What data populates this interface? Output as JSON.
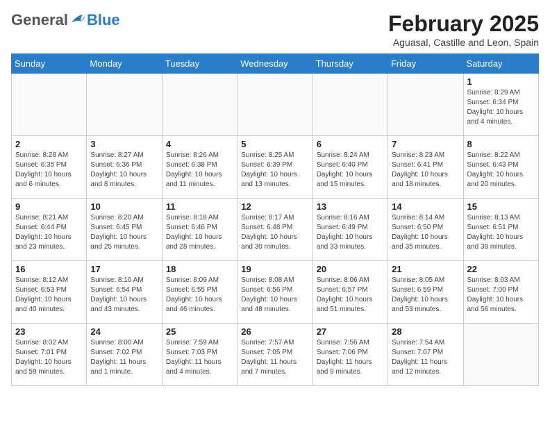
{
  "header": {
    "logo_general": "General",
    "logo_blue": "Blue",
    "month": "February 2025",
    "location": "Aguasal, Castille and Leon, Spain"
  },
  "weekdays": [
    "Sunday",
    "Monday",
    "Tuesday",
    "Wednesday",
    "Thursday",
    "Friday",
    "Saturday"
  ],
  "weeks": [
    [
      {
        "day": "",
        "info": ""
      },
      {
        "day": "",
        "info": ""
      },
      {
        "day": "",
        "info": ""
      },
      {
        "day": "",
        "info": ""
      },
      {
        "day": "",
        "info": ""
      },
      {
        "day": "",
        "info": ""
      },
      {
        "day": "1",
        "info": "Sunrise: 8:29 AM\nSunset: 6:34 PM\nDaylight: 10 hours\nand 4 minutes."
      }
    ],
    [
      {
        "day": "2",
        "info": "Sunrise: 8:28 AM\nSunset: 6:35 PM\nDaylight: 10 hours\nand 6 minutes."
      },
      {
        "day": "3",
        "info": "Sunrise: 8:27 AM\nSunset: 6:36 PM\nDaylight: 10 hours\nand 8 minutes."
      },
      {
        "day": "4",
        "info": "Sunrise: 8:26 AM\nSunset: 6:38 PM\nDaylight: 10 hours\nand 11 minutes."
      },
      {
        "day": "5",
        "info": "Sunrise: 8:25 AM\nSunset: 6:39 PM\nDaylight: 10 hours\nand 13 minutes."
      },
      {
        "day": "6",
        "info": "Sunrise: 8:24 AM\nSunset: 6:40 PM\nDaylight: 10 hours\nand 15 minutes."
      },
      {
        "day": "7",
        "info": "Sunrise: 8:23 AM\nSunset: 6:41 PM\nDaylight: 10 hours\nand 18 minutes."
      },
      {
        "day": "8",
        "info": "Sunrise: 8:22 AM\nSunset: 6:43 PM\nDaylight: 10 hours\nand 20 minutes."
      }
    ],
    [
      {
        "day": "9",
        "info": "Sunrise: 8:21 AM\nSunset: 6:44 PM\nDaylight: 10 hours\nand 23 minutes."
      },
      {
        "day": "10",
        "info": "Sunrise: 8:20 AM\nSunset: 6:45 PM\nDaylight: 10 hours\nand 25 minutes."
      },
      {
        "day": "11",
        "info": "Sunrise: 8:18 AM\nSunset: 6:46 PM\nDaylight: 10 hours\nand 28 minutes."
      },
      {
        "day": "12",
        "info": "Sunrise: 8:17 AM\nSunset: 6:48 PM\nDaylight: 10 hours\nand 30 minutes."
      },
      {
        "day": "13",
        "info": "Sunrise: 8:16 AM\nSunset: 6:49 PM\nDaylight: 10 hours\nand 33 minutes."
      },
      {
        "day": "14",
        "info": "Sunrise: 8:14 AM\nSunset: 6:50 PM\nDaylight: 10 hours\nand 35 minutes."
      },
      {
        "day": "15",
        "info": "Sunrise: 8:13 AM\nSunset: 6:51 PM\nDaylight: 10 hours\nand 38 minutes."
      }
    ],
    [
      {
        "day": "16",
        "info": "Sunrise: 8:12 AM\nSunset: 6:53 PM\nDaylight: 10 hours\nand 40 minutes."
      },
      {
        "day": "17",
        "info": "Sunrise: 8:10 AM\nSunset: 6:54 PM\nDaylight: 10 hours\nand 43 minutes."
      },
      {
        "day": "18",
        "info": "Sunrise: 8:09 AM\nSunset: 6:55 PM\nDaylight: 10 hours\nand 46 minutes."
      },
      {
        "day": "19",
        "info": "Sunrise: 8:08 AM\nSunset: 6:56 PM\nDaylight: 10 hours\nand 48 minutes."
      },
      {
        "day": "20",
        "info": "Sunrise: 8:06 AM\nSunset: 6:57 PM\nDaylight: 10 hours\nand 51 minutes."
      },
      {
        "day": "21",
        "info": "Sunrise: 8:05 AM\nSunset: 6:59 PM\nDaylight: 10 hours\nand 53 minutes."
      },
      {
        "day": "22",
        "info": "Sunrise: 8:03 AM\nSunset: 7:00 PM\nDaylight: 10 hours\nand 56 minutes."
      }
    ],
    [
      {
        "day": "23",
        "info": "Sunrise: 8:02 AM\nSunset: 7:01 PM\nDaylight: 10 hours\nand 59 minutes."
      },
      {
        "day": "24",
        "info": "Sunrise: 8:00 AM\nSunset: 7:02 PM\nDaylight: 11 hours\nand 1 minute."
      },
      {
        "day": "25",
        "info": "Sunrise: 7:59 AM\nSunset: 7:03 PM\nDaylight: 11 hours\nand 4 minutes."
      },
      {
        "day": "26",
        "info": "Sunrise: 7:57 AM\nSunset: 7:05 PM\nDaylight: 11 hours\nand 7 minutes."
      },
      {
        "day": "27",
        "info": "Sunrise: 7:56 AM\nSunset: 7:06 PM\nDaylight: 11 hours\nand 9 minutes."
      },
      {
        "day": "28",
        "info": "Sunrise: 7:54 AM\nSunset: 7:07 PM\nDaylight: 11 hours\nand 12 minutes."
      },
      {
        "day": "",
        "info": ""
      }
    ]
  ]
}
